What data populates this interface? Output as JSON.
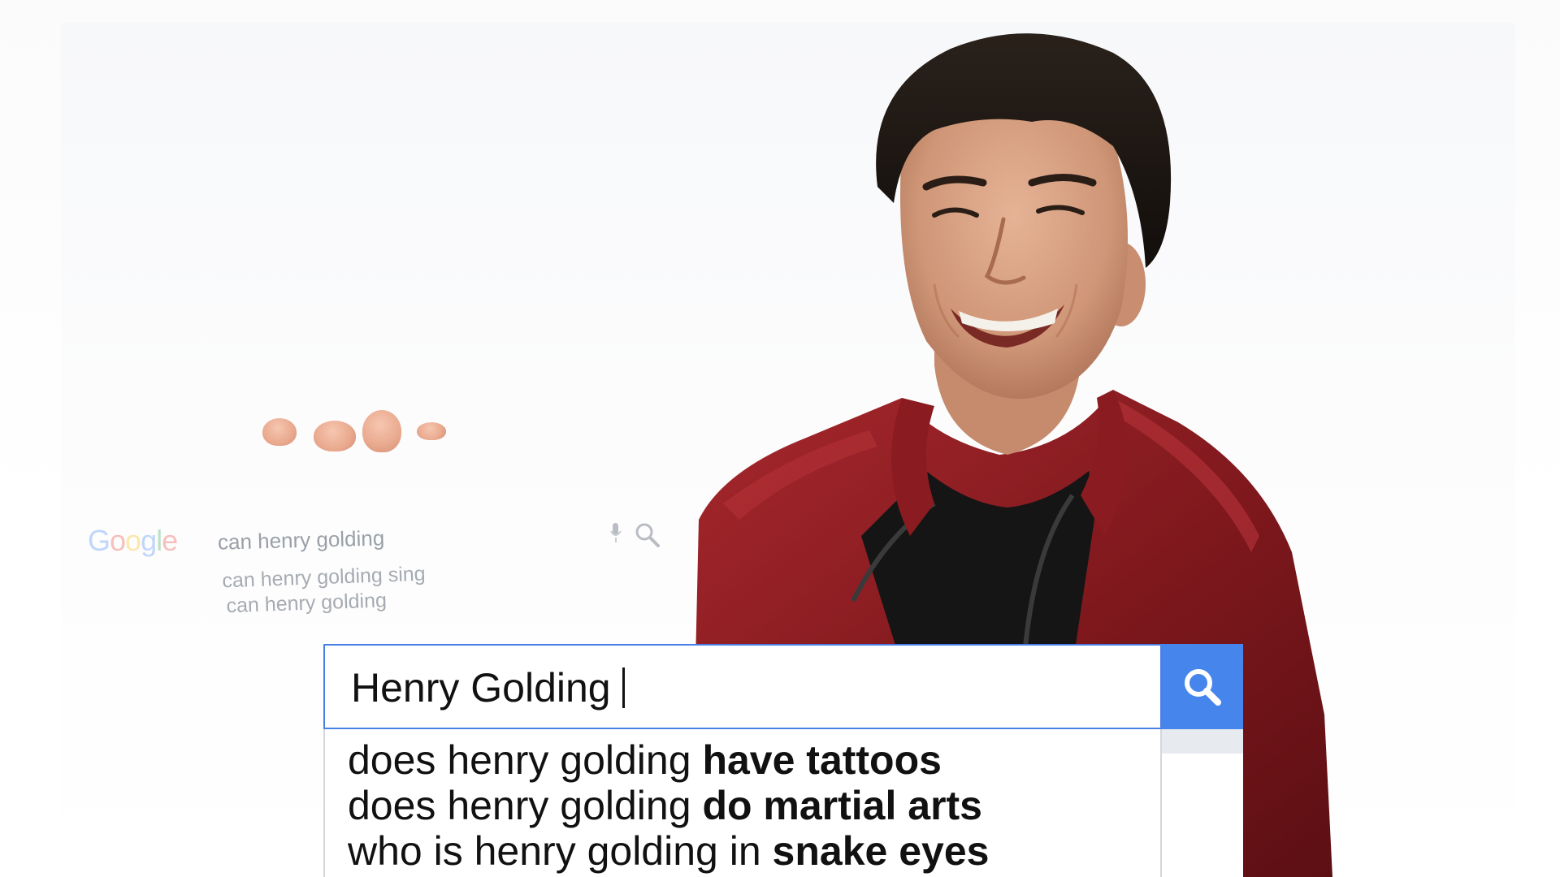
{
  "search": {
    "query": "Henry Golding",
    "button_icon": "search-icon",
    "button_color": "#4585ec",
    "border_color": "#4a80e6"
  },
  "suggestions": [
    {
      "prefix": "does henry golding ",
      "bold": "have tattoos"
    },
    {
      "prefix": "does henry golding ",
      "bold": "do martial arts"
    },
    {
      "prefix": "who is henry golding in ",
      "bold": "snake eyes"
    }
  ],
  "background_card": {
    "logo": "Google",
    "query": "can henry golding",
    "suggestions": [
      "can henry golding sing",
      "can henry golding"
    ],
    "mic_icon": "mic-icon",
    "search_icon": "search-icon"
  },
  "colors": {
    "jacket": "#8e1f24",
    "skin": "#d9a486",
    "hair": "#1e1814"
  }
}
